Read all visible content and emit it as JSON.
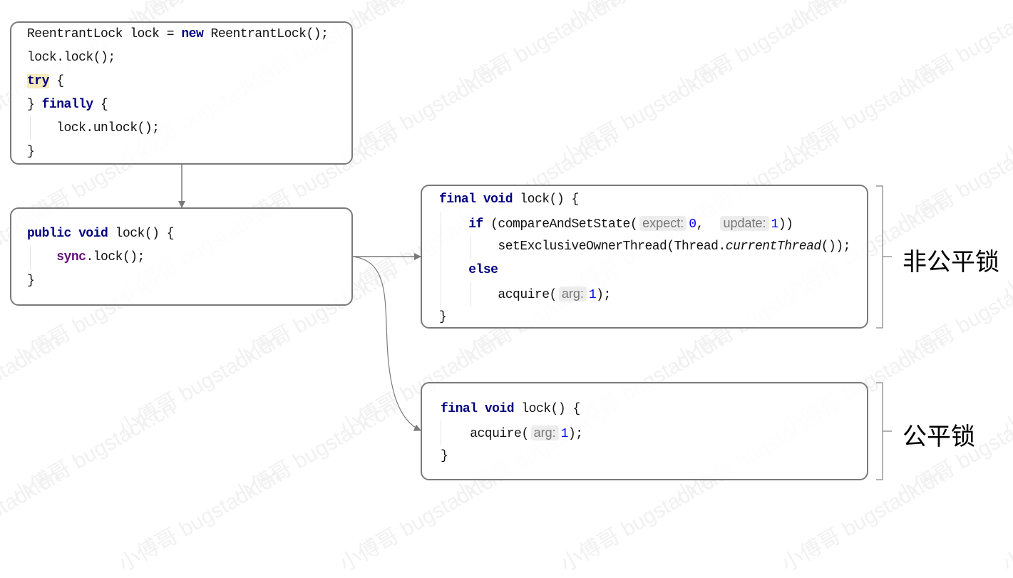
{
  "watermark": {
    "text": "小傅哥 bugstack.cn"
  },
  "box_usage": {
    "lines": [
      {
        "parts": [
          {
            "t": "ReentrantLock lock = "
          },
          {
            "t": "new",
            "c": "kw"
          },
          {
            "t": " ReentrantLock();"
          }
        ]
      },
      {
        "parts": [
          {
            "t": "lock.lock();"
          }
        ]
      },
      {
        "parts": [
          {
            "t": "try",
            "c": "kw tryhl"
          },
          {
            "t": " {"
          }
        ]
      },
      {
        "parts": [
          {
            "t": "} "
          },
          {
            "t": "finally",
            "c": "kw"
          },
          {
            "t": " {"
          }
        ]
      },
      {
        "parts": [
          {
            "t": "    lock.unlock();"
          }
        ]
      },
      {
        "parts": [
          {
            "t": "}"
          }
        ]
      }
    ]
  },
  "box_lock": {
    "lines": [
      {
        "parts": [
          {
            "t": "public",
            "c": "kw"
          },
          {
            "t": " "
          },
          {
            "t": "void",
            "c": "kw"
          },
          {
            "t": " lock() {"
          }
        ]
      },
      {
        "parts": [
          {
            "t": "    "
          },
          {
            "t": "sync",
            "c": "field"
          },
          {
            "t": ".lock();"
          }
        ]
      },
      {
        "parts": [
          {
            "t": "}"
          }
        ]
      }
    ]
  },
  "box_nonfair": {
    "lines": [
      {
        "parts": [
          {
            "t": "final",
            "c": "kw"
          },
          {
            "t": " "
          },
          {
            "t": "void",
            "c": "kw"
          },
          {
            "t": " lock() {"
          }
        ]
      },
      {
        "parts": [
          {
            "t": "    "
          },
          {
            "t": "if",
            "c": "kw"
          },
          {
            "t": " (compareAndSetState("
          },
          {
            "t": "expect:",
            "c": "hint"
          },
          {
            "t": "0",
            "c": "num"
          },
          {
            "t": ",  "
          },
          {
            "t": "update:",
            "c": "hint"
          },
          {
            "t": "1",
            "c": "num"
          },
          {
            "t": "))"
          }
        ]
      },
      {
        "parts": [
          {
            "t": "        setExclusiveOwnerThread(Thread."
          },
          {
            "t": "currentThread",
            "c": "it"
          },
          {
            "t": "());"
          }
        ]
      },
      {
        "parts": [
          {
            "t": "    "
          },
          {
            "t": "else",
            "c": "kw"
          }
        ]
      },
      {
        "parts": [
          {
            "t": "        acquire("
          },
          {
            "t": "arg:",
            "c": "hint"
          },
          {
            "t": "1",
            "c": "num"
          },
          {
            "t": ");"
          }
        ]
      },
      {
        "parts": [
          {
            "t": "}"
          }
        ]
      }
    ]
  },
  "box_fair": {
    "lines": [
      {
        "parts": [
          {
            "t": "final",
            "c": "kw"
          },
          {
            "t": " "
          },
          {
            "t": "void",
            "c": "kw"
          },
          {
            "t": " lock() {"
          }
        ]
      },
      {
        "parts": [
          {
            "t": "    acquire("
          },
          {
            "t": "arg:",
            "c": "hint"
          },
          {
            "t": "1",
            "c": "num"
          },
          {
            "t": ");"
          }
        ]
      },
      {
        "parts": [
          {
            "t": "}"
          }
        ]
      }
    ]
  },
  "labels": {
    "nonfair": "非公平锁",
    "fair": "公平锁"
  }
}
